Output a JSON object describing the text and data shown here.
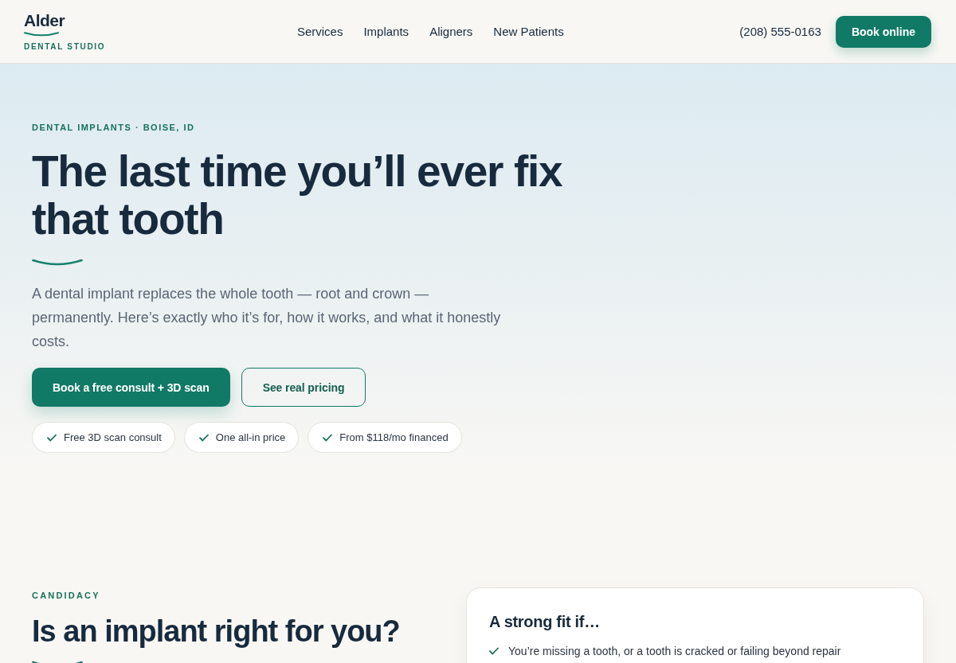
{
  "header": {
    "logo": {
      "name": "Alder",
      "tagline": "DENTAL STUDIO"
    },
    "nav": [
      {
        "label": "Services"
      },
      {
        "label": "Implants"
      },
      {
        "label": "Aligners"
      },
      {
        "label": "New Patients"
      }
    ],
    "phone": "(208) 555-0163",
    "cta": "Book online"
  },
  "hero": {
    "eyebrow": "DENTAL IMPLANTS · BOISE, ID",
    "title": "The last time you’ll ever fix that tooth",
    "lead": "A dental implant replaces the whole tooth — root and crown — permanently. Here’s exactly who it’s for, how it works, and what it honestly costs.",
    "buttons": [
      {
        "label": "Book a free consult + 3D scan",
        "kind": "primary"
      },
      {
        "label": "See real pricing",
        "kind": "secondary"
      }
    ],
    "highlights": [
      {
        "label": "Free 3D scan consult"
      },
      {
        "label": "One all-in price"
      },
      {
        "label": "From $118/mo financed"
      }
    ]
  },
  "candidacy": {
    "eyebrow": "CANDIDACY",
    "title": "Is an implant right for you?",
    "card": {
      "title": "A strong fit if…",
      "items": [
        {
          "text": "You’re missing a tooth, or a tooth is cracked or failing beyond repair"
        }
      ]
    }
  }
}
